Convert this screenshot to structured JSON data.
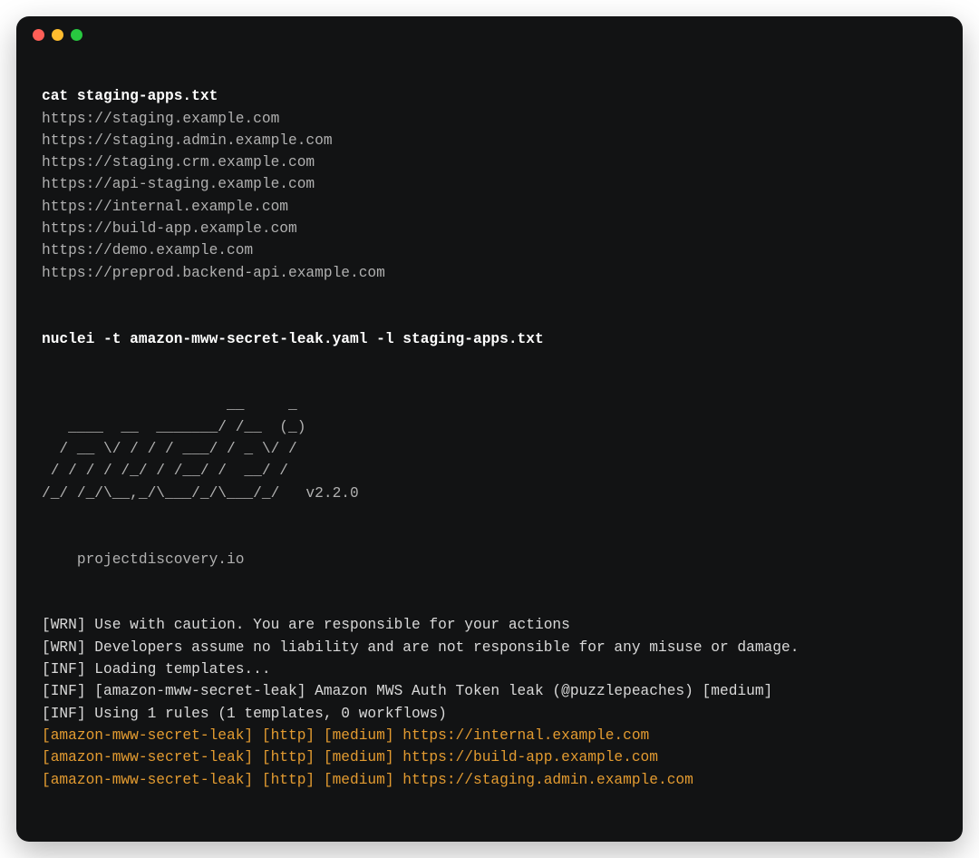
{
  "commands": {
    "cat": "cat staging-apps.txt",
    "nuclei": "nuclei -t amazon-mww-secret-leak.yaml -l staging-apps.txt"
  },
  "file_lines": [
    "https://staging.example.com",
    "https://staging.admin.example.com",
    "https://staging.crm.example.com",
    "https://api-staging.example.com",
    "https://internal.example.com",
    "https://build-app.example.com",
    "https://demo.example.com",
    "https://preprod.backend-api.example.com"
  ],
  "banner": [
    "                     __     _",
    "   ____  __  _______/ /__  (_)",
    "  / __ \\/ / / / ___/ / _ \\/ /",
    " / / / / /_/ / /__/ /  __/ /",
    "/_/ /_/\\__,_/\\___/_/\\___/_/   v2.2.0"
  ],
  "tagline": "    projectdiscovery.io",
  "log_lines": [
    "[WRN] Use with caution. You are responsible for your actions",
    "[WRN] Developers assume no liability and are not responsible for any misuse or damage.",
    "[INF] Loading templates...",
    "[INF] [amazon-mww-secret-leak] Amazon MWS Auth Token leak (@puzzlepeaches) [medium]",
    "[INF] Using 1 rules (1 templates, 0 workflows)"
  ],
  "result_lines": [
    "[amazon-mww-secret-leak] [http] [medium] https://internal.example.com",
    "[amazon-mww-secret-leak] [http] [medium] https://build-app.example.com",
    "[amazon-mww-secret-leak] [http] [medium] https://staging.admin.example.com"
  ]
}
